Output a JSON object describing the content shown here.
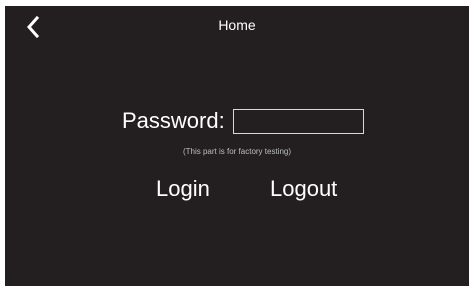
{
  "header": {
    "back_icon": "chevron-left-icon",
    "title": "Home"
  },
  "form": {
    "password_label": "Password:",
    "password_value": "",
    "note": "(This part is for factory testing)"
  },
  "actions": {
    "login_label": "Login",
    "logout_label": "Logout"
  },
  "colors": {
    "background": "#231f20",
    "text": "#ffffff",
    "muted_text": "#bdbdbd",
    "input_border": "#d8d8d8"
  }
}
